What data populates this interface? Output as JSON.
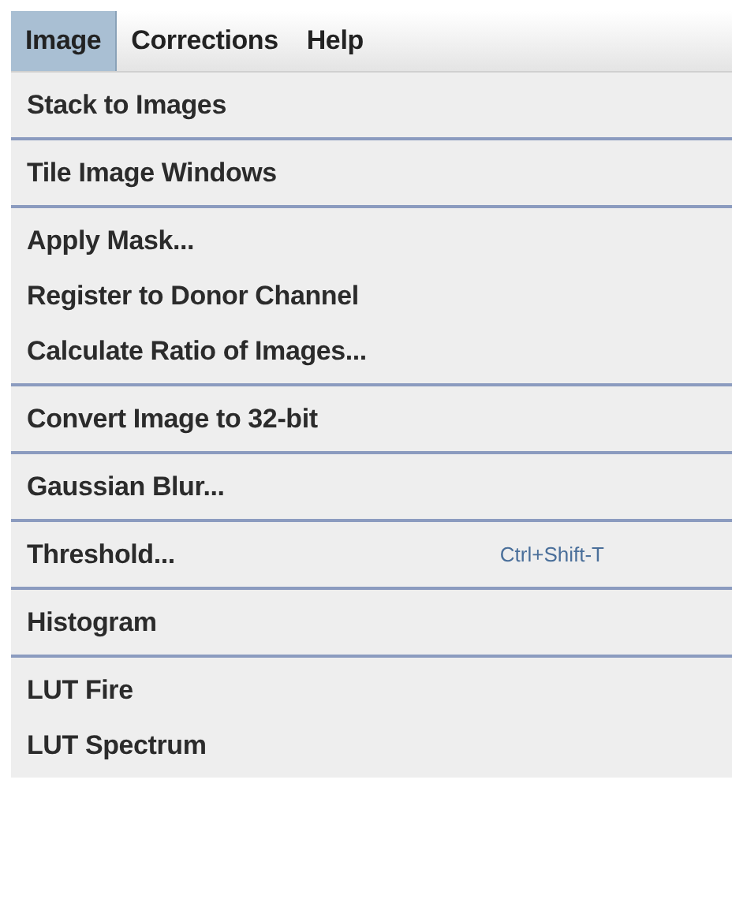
{
  "menu_bar": [
    {
      "label": "Image",
      "selected": true
    },
    {
      "label": "Corrections",
      "selected": false
    },
    {
      "label": "Help",
      "selected": false
    }
  ],
  "menu_groups": [
    {
      "items": [
        {
          "label": "Stack to Images"
        }
      ]
    },
    {
      "items": [
        {
          "label": "Tile Image Windows"
        }
      ]
    },
    {
      "items": [
        {
          "label": "Apply Mask..."
        },
        {
          "label": "Register to Donor Channel"
        },
        {
          "label": "Calculate Ratio of Images..."
        }
      ]
    },
    {
      "items": [
        {
          "label": "Convert Image to 32-bit"
        }
      ]
    },
    {
      "items": [
        {
          "label": "Gaussian Blur..."
        }
      ]
    },
    {
      "items": [
        {
          "label": "Threshold...",
          "shortcut": "Ctrl+Shift-T"
        }
      ]
    },
    {
      "items": [
        {
          "label": "Histogram"
        }
      ]
    },
    {
      "items": [
        {
          "label": "LUT Fire"
        },
        {
          "label": "LUT Spectrum"
        }
      ]
    }
  ]
}
